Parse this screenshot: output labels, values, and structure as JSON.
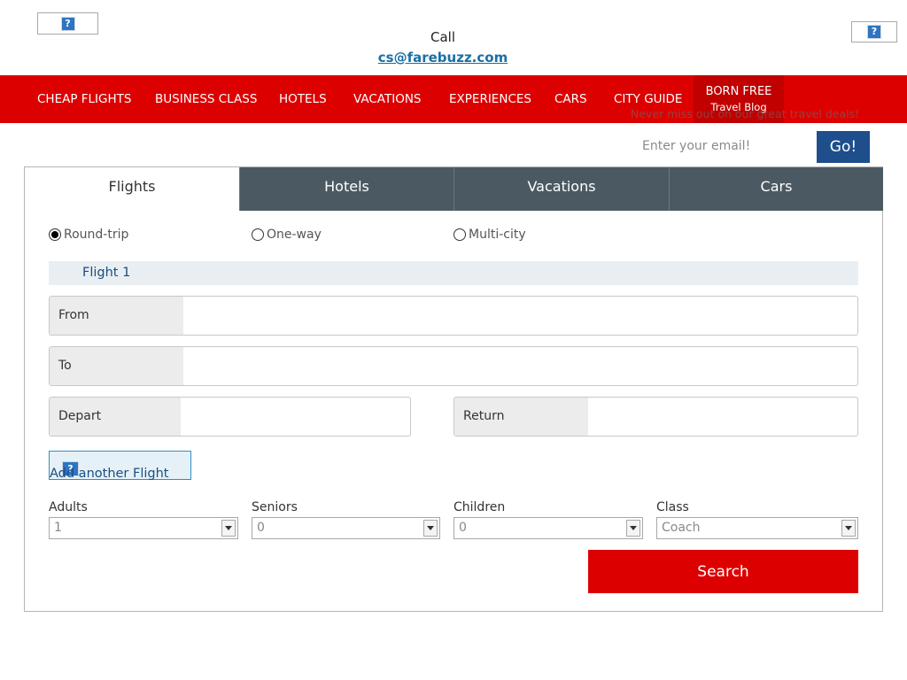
{
  "header": {
    "call_label": "Call",
    "email": "cs@farebuzz.com",
    "logo_left_icon": "broken-image-icon",
    "logo_right_icon": "broken-image-icon",
    "broken_glyph": "?"
  },
  "nav": {
    "items": [
      "CHEAP FLIGHTS",
      "BUSINESS CLASS",
      "HOTELS",
      "VACATIONS",
      "EXPERIENCES",
      "CARS",
      "CITY GUIDE"
    ],
    "blog_line1": "BORN FREE",
    "blog_line2": "Travel Blog",
    "color": "#dd0000"
  },
  "newsletter": {
    "text": "Never miss out on our great travel deals!",
    "placeholder": "Enter your email!",
    "button": "Go!"
  },
  "search_panel": {
    "tabs": [
      "Flights",
      "Hotels",
      "Vacations",
      "Cars"
    ],
    "active_tab": "Flights",
    "trip_types": [
      "Round-trip",
      "One-way",
      "Multi-city"
    ],
    "selected_trip_type": "Round-trip",
    "flight_header": "Flight 1",
    "fields": {
      "from": "From",
      "to": "To",
      "depart": "Depart",
      "return": "Return"
    },
    "add_flight": "Add another Flight",
    "selects": [
      {
        "label": "Adults",
        "value": "1"
      },
      {
        "label": "Seniors",
        "value": "0"
      },
      {
        "label": "Children",
        "value": "0"
      },
      {
        "label": "Class",
        "value": "Coach"
      }
    ],
    "search_button": "Search"
  }
}
